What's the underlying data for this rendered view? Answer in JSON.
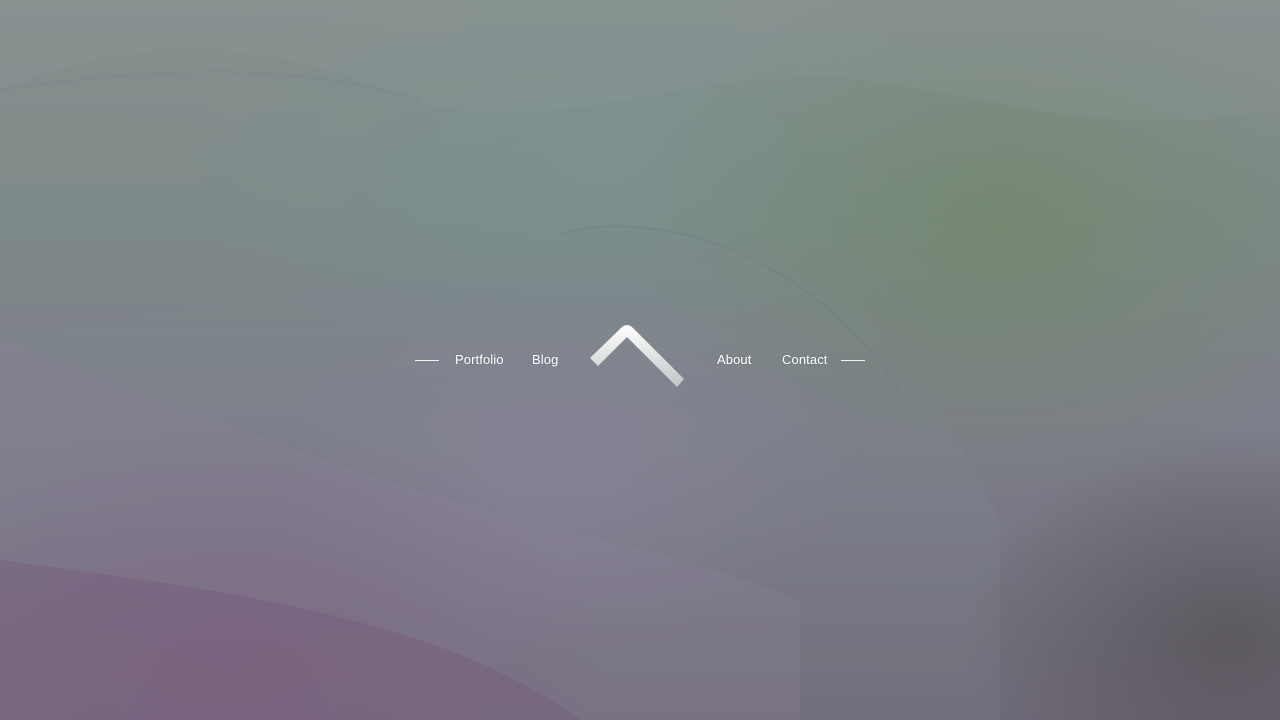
{
  "nav": {
    "left_items": [
      {
        "label": "Portfolio"
      },
      {
        "label": "Blog"
      }
    ],
    "right_items": [
      {
        "label": "About"
      },
      {
        "label": "Contact"
      }
    ],
    "logo_icon": "chevron-up-logo-icon"
  },
  "colors": {
    "text": "#ffffff",
    "logo_top": "#ffffff",
    "logo_bottom": "#b9bdbd"
  }
}
